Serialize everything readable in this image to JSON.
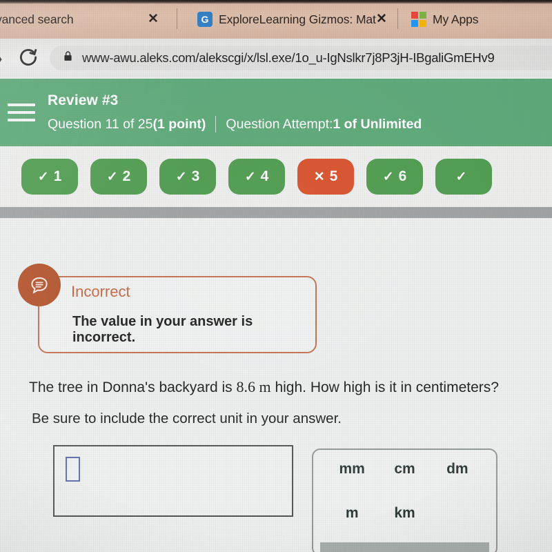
{
  "browser": {
    "tabs": [
      {
        "title": "vanced search",
        "favicon": "none",
        "close_label": "✕"
      },
      {
        "title": "ExploreLearning Gizmos: Mat",
        "favicon": "gizmos-g-icon",
        "favicon_letter": "G",
        "close_label": "✕"
      },
      {
        "title": "My Apps",
        "favicon": "microsoft-logo-icon",
        "close_label": ""
      }
    ],
    "toolbar": {
      "back_glyph": "›",
      "reload_name": "reload-icon",
      "lock_name": "lock-icon",
      "url": "www-awu.aleks.com/alekscgi/x/lsl.exe/1o_u-IgNslkr7j8P3jH-IBgaliGmEHv9"
    }
  },
  "header": {
    "menu_icon": "hamburger-menu-icon",
    "review_title": "Review #3",
    "question_label": "Question 11 of 25 ",
    "points": "(1 point)",
    "attempt_label": "Question Attempt: ",
    "attempt_value": "1 of Unlimited"
  },
  "progress": {
    "pills": [
      {
        "number": "1",
        "status": "correct",
        "mark": "✓"
      },
      {
        "number": "2",
        "status": "correct",
        "mark": "✓"
      },
      {
        "number": "3",
        "status": "correct",
        "mark": "✓"
      },
      {
        "number": "4",
        "status": "correct",
        "mark": "✓"
      },
      {
        "number": "5",
        "status": "incorrect",
        "mark": "✕"
      },
      {
        "number": "6",
        "status": "correct",
        "mark": "✓"
      },
      {
        "number": "",
        "status": "correct",
        "mark": "✓"
      }
    ]
  },
  "feedback": {
    "icon": "speech-bubble-icon",
    "title": "Incorrect",
    "message": "The value in your answer is incorrect."
  },
  "question": {
    "text_before": "The tree in Donna's backyard is ",
    "value": "8.6 m",
    "text_after": " high. How high is it in centimeters?",
    "instruction": "Be sure to include the correct unit in your answer."
  },
  "answer": {
    "value": "",
    "placeholder": ""
  },
  "units": {
    "row1": [
      "mm",
      "cm",
      "dm"
    ],
    "row2": [
      "m",
      "km",
      ""
    ]
  },
  "colors": {
    "header_green": "#5ca877",
    "pill_correct": "#4e9b4e",
    "pill_incorrect": "#d9502a",
    "feedback_orange": "#b4512a",
    "feedback_border": "#c4704e",
    "tabstrip": "#dcbda9"
  }
}
